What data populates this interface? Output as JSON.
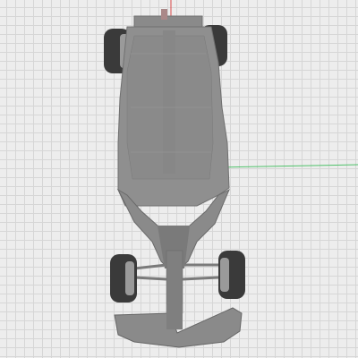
{
  "viewport": {
    "grid": true,
    "axes": {
      "x_axis_color": "#4fc26a",
      "y_axis_color": "#d94a4a"
    }
  },
  "model": {
    "name": "race-car-top-view",
    "body_color": "#8f8f8f",
    "body_shade_color": "#7a7a7a",
    "tire_color": "#3a3a3a",
    "rim_color": "#9a9a9a"
  },
  "toolbar": {}
}
